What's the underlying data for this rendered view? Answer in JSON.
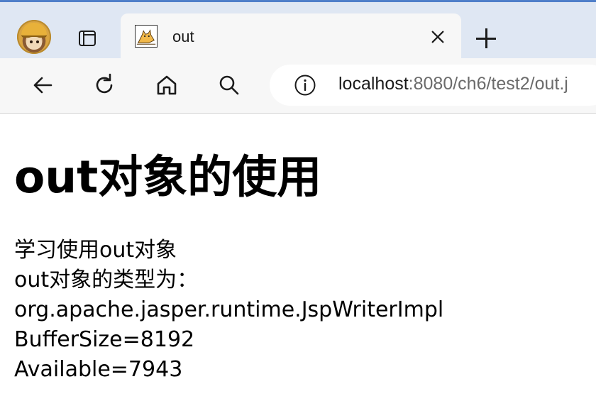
{
  "tab": {
    "title": "out"
  },
  "address": {
    "host": "localhost",
    "rest": ":8080/ch6/test2/out.j"
  },
  "page": {
    "heading": "out对象的使用",
    "lines": [
      "学习使用out对象",
      "out对象的类型为：",
      "org.apache.jasper.runtime.JspWriterImpl",
      "BufferSize=8192",
      "Available=7943"
    ]
  },
  "icons": {
    "profile": "profile-avatar-icon",
    "tab_actions": "tab-actions-icon",
    "favicon": "tomcat-favicon-icon",
    "close": "close-icon",
    "new_tab": "plus-icon",
    "back": "back-arrow-icon",
    "refresh": "refresh-icon",
    "home": "home-icon",
    "search": "search-icon",
    "info": "info-icon"
  },
  "colors": {
    "tabstrip_bg": "#dfe7f3",
    "toolbar_bg": "#f7f7f7",
    "url_path": "#6b6b6b"
  }
}
